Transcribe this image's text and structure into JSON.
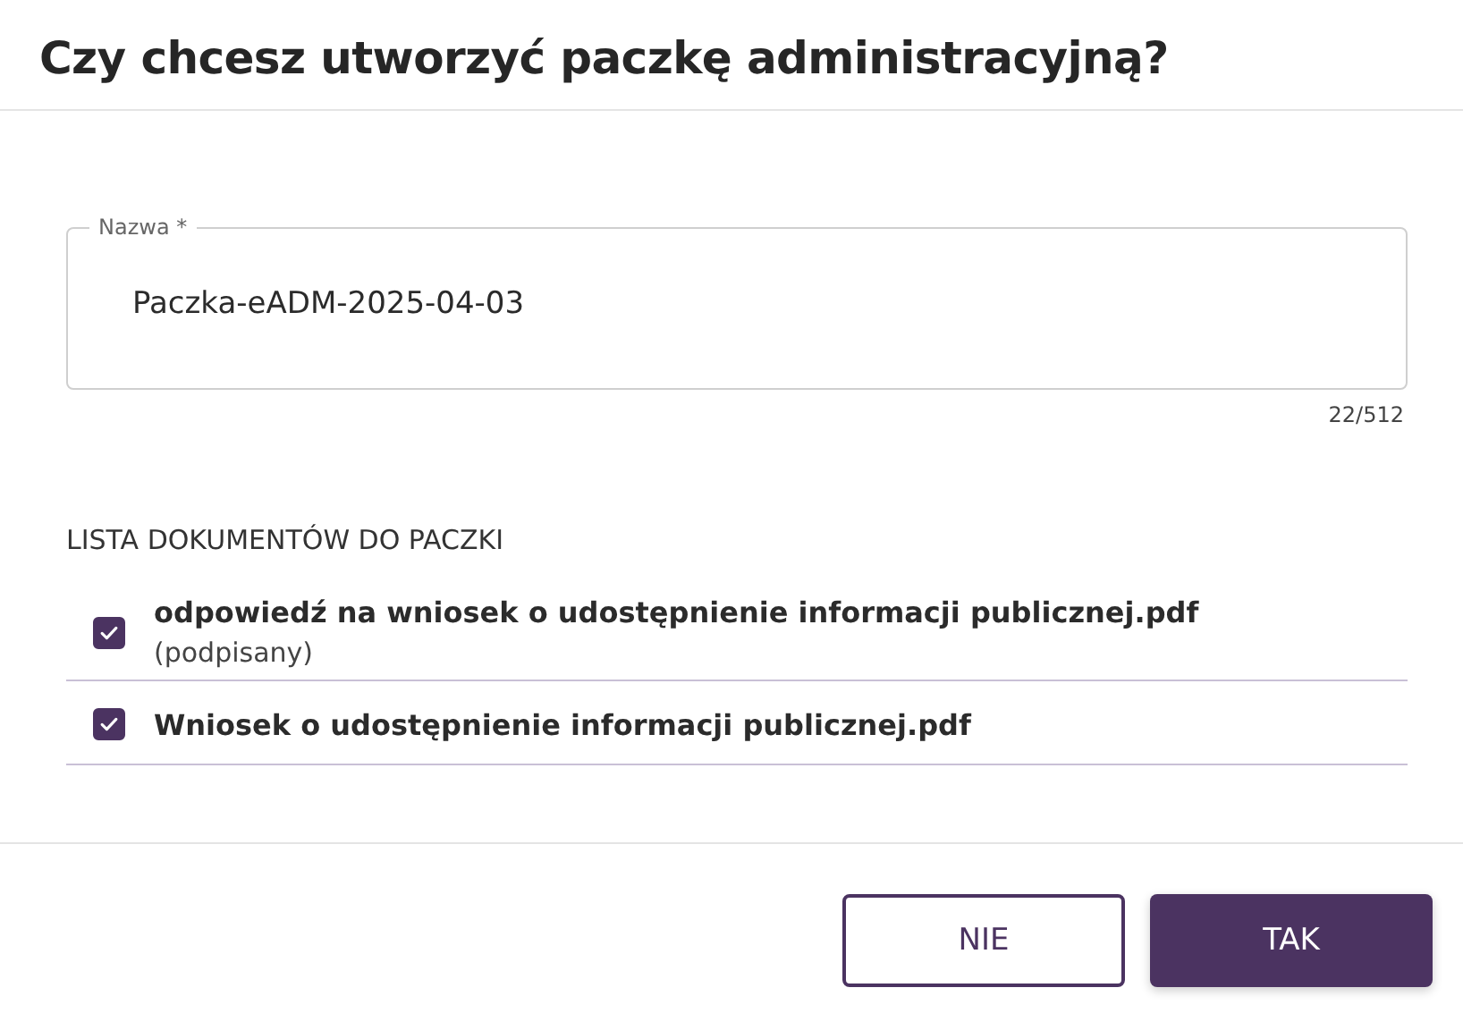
{
  "dialog": {
    "title": "Czy chcesz utworzyć paczkę administracyjną?"
  },
  "name_field": {
    "label": "Nazwa",
    "required": true,
    "required_mark": "*",
    "value": "Paczka-eADM-2025-04-03",
    "counter": "22/512"
  },
  "documents": {
    "heading": "LISTA DOKUMENTÓW DO PACZKI",
    "items": [
      {
        "name": "odpowiedź na wniosek o udostępnienie informacji publicznej.pdf",
        "note": "(podpisany)",
        "checked": true
      },
      {
        "name": "Wniosek o udostępnienie informacji publicznej.pdf",
        "checked": true
      }
    ]
  },
  "buttons": [
    {
      "label": "NIE",
      "kind": "secondary"
    },
    {
      "label": "TAK",
      "kind": "primary"
    }
  ]
}
